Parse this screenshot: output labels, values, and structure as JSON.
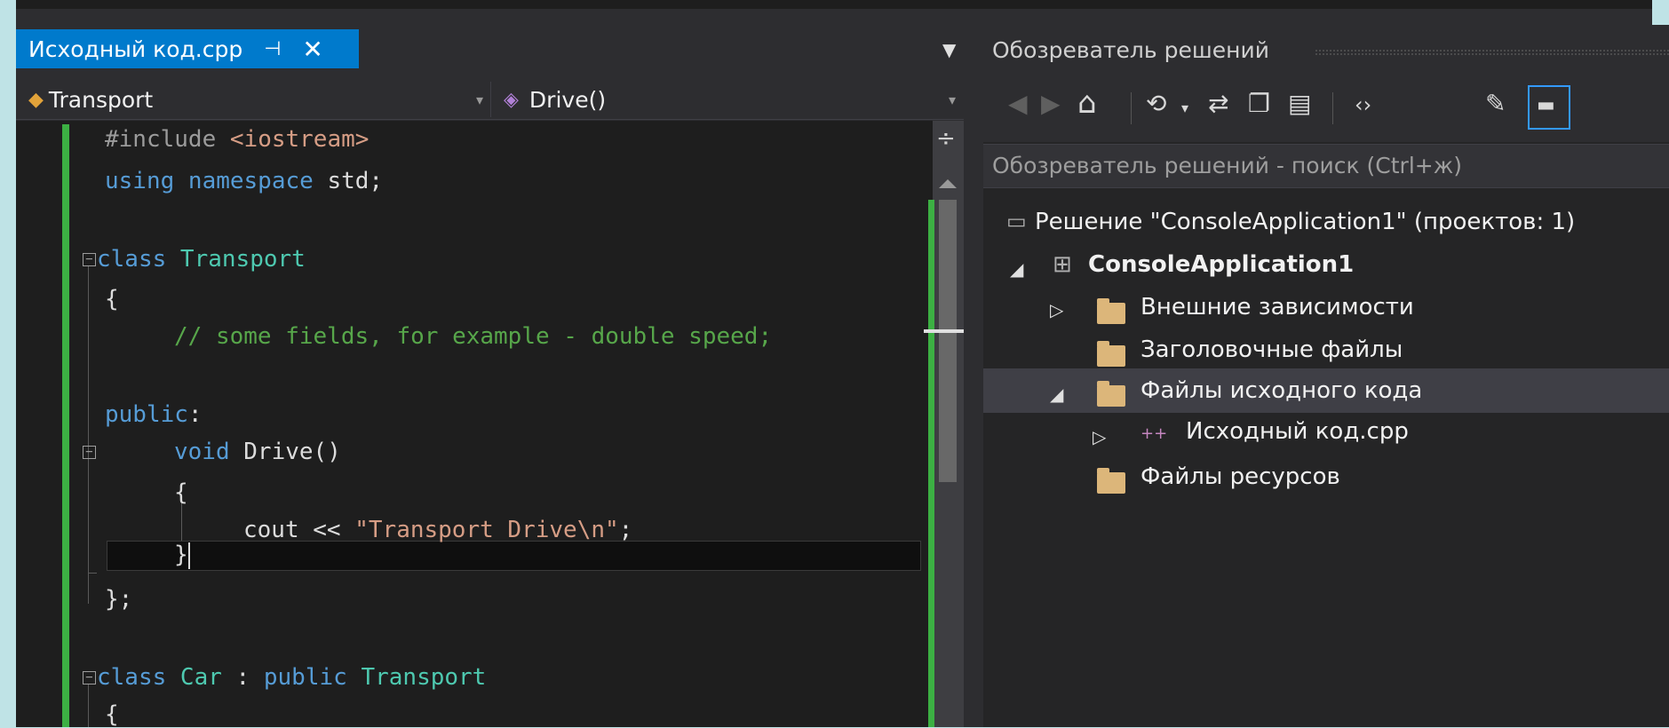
{
  "editor": {
    "tab_title": "Исходный код.cpp",
    "tab_pin": "⊣",
    "tab_close": "✕",
    "tab_overflow": "▼",
    "nav_class": "Transport",
    "nav_member": "Drive()",
    "nav_dropdown": "▾",
    "splitter_icon": "÷",
    "code": {
      "l1_pp": "#include ",
      "l1_hdr": "<iostream>",
      "l2_kw": "using namespace",
      "l2_rest": " std;",
      "l3_kw": "class",
      "l3_ty": " Transport",
      "l4": "{",
      "l5_cm": "// some fields, for example - double speed;",
      "l6_kw": "public",
      "l6_rest": ":",
      "l7_kw": "void",
      "l7_rest": " Drive()",
      "l8": "{",
      "l9_a": "cout << ",
      "l9_str": "\"Transport Drive\\n\"",
      "l9_b": ";",
      "l10": "}",
      "l11": "};",
      "l12_kw": "class",
      "l12_ty": " Car",
      "l12_mid": " : ",
      "l12_kw2": "public",
      "l12_ty2": " Transport",
      "l13": "{",
      "fold_minus": "−"
    }
  },
  "solution_explorer": {
    "title": "Обозреватель решений",
    "search_placeholder": "Обозреватель решений - поиск (Ctrl+ж)",
    "toolbar_icons": [
      "back-icon",
      "forward-icon",
      "home-icon",
      "history-icon",
      "sync-icon",
      "collapse-all-icon",
      "show-all-files-icon",
      "code-view-icon",
      "properties-icon",
      "preview-icon"
    ],
    "toolbar_glyphs": {
      "back": "◀",
      "forward": "▶",
      "home": "⌂",
      "history": "⟲",
      "history_dd": "▾",
      "sync": "⇄",
      "collapse": "❐",
      "showall": "▤",
      "code": "‹›",
      "props": "✎",
      "preview": "▬"
    },
    "tree": {
      "solution": "Решение \"ConsoleApplication1\"  (проектов: 1)",
      "project": "ConsoleApplication1",
      "external_deps": "Внешние зависимости",
      "header_files": "Заголовочные файлы",
      "source_files": "Файлы исходного кода",
      "source_file": "Исходный код.cpp",
      "resource_files": "Файлы ресурсов",
      "expanded_arrow": "◢",
      "collapsed_arrow": "▷",
      "cpp_icon": "++",
      "solution_icon": "▭",
      "project_icon": "⊞"
    }
  },
  "colors": {
    "accent": "#007acc",
    "change_bar": "#3cb043"
  }
}
